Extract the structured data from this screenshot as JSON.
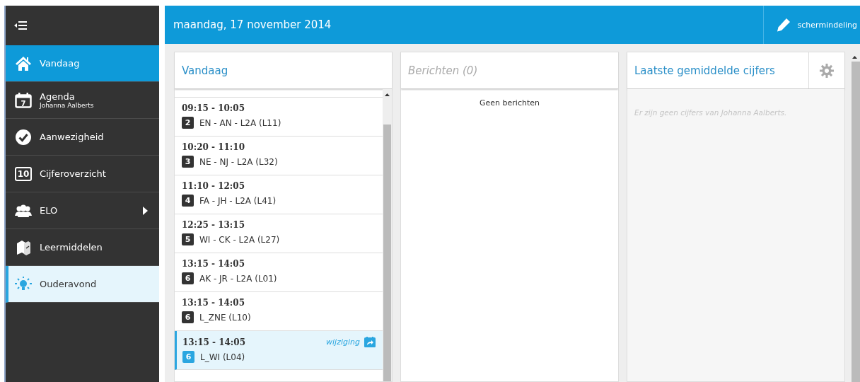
{
  "sidebar": {
    "items": [
      {
        "label": "Vandaag",
        "selected": true,
        "highlighted": false,
        "has_submenu": false
      },
      {
        "label": "Agenda",
        "sublabel": "Johanna Aalberts",
        "selected": false,
        "highlighted": false,
        "has_submenu": false
      },
      {
        "label": "Aanwezigheid",
        "selected": false,
        "highlighted": false,
        "has_submenu": false
      },
      {
        "label": "Cijferoverzicht",
        "icon_text": "10",
        "selected": false,
        "highlighted": false,
        "has_submenu": false
      },
      {
        "label": "ELO",
        "selected": false,
        "highlighted": false,
        "has_submenu": true
      },
      {
        "label": "Leermiddelen",
        "selected": false,
        "highlighted": false,
        "has_submenu": false
      },
      {
        "label": "Ouderavond",
        "selected": false,
        "highlighted": true,
        "has_submenu": false
      }
    ],
    "calendar_day": "7"
  },
  "header": {
    "date": "maandag, 17 november 2014",
    "layout_button": "schermindeling"
  },
  "panels": {
    "today": {
      "title": "Vandaag",
      "lessons": [
        {
          "time": "09:15 - 10:05",
          "hour": "2",
          "label": "EN - AN - L2A (L11)",
          "changed": false
        },
        {
          "time": "10:20 - 11:10",
          "hour": "3",
          "label": "NE - NJ - L2A (L32)",
          "changed": false
        },
        {
          "time": "11:10 - 12:05",
          "hour": "4",
          "label": "FA - JH - L2A (L41)",
          "changed": false
        },
        {
          "time": "12:25 - 13:15",
          "hour": "5",
          "label": "WI - CK - L2A (L27)",
          "changed": false
        },
        {
          "time": "13:15 - 14:05",
          "hour": "6",
          "label": "AK - JR - L2A (L01)",
          "changed": false
        },
        {
          "time": "13:15 - 14:05",
          "hour": "6",
          "label": "L_ZNE (L10)",
          "changed": false
        },
        {
          "time": "13:15 - 14:05",
          "hour": "6",
          "label": "L_WI (L04)",
          "changed": true,
          "change_label": "wijziging"
        }
      ]
    },
    "messages": {
      "title": "Berichten (0)",
      "empty": "Geen berichten"
    },
    "grades": {
      "title": "Laatste gemiddelde cijfers",
      "empty": "Er zijn geen cijfers van Johanna Aalberts."
    }
  }
}
